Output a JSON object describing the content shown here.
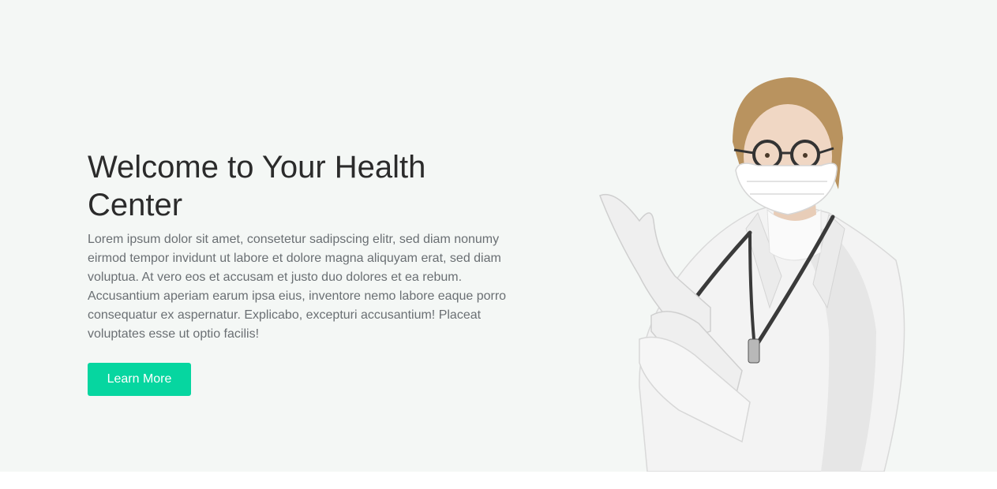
{
  "hero": {
    "title": "Welcome to Your Health Center",
    "description": "Lorem ipsum dolor sit amet, consetetur sadipscing elitr, sed diam nonumy eirmod tempor invidunt ut labore et dolore magna aliquyam erat, sed diam voluptua. At vero eos et accusam et justo duo dolores et ea rebum. Accusantium aperiam earum ipsa eius, inventore nemo labore eaque porro consequatur ex aspernatur. Explicabo, excepturi accusantium! Placeat voluptates esse ut optio facilis!",
    "button_label": "Learn More"
  },
  "colors": {
    "accent": "#06d6a0",
    "hero_background": "#f4f7f5",
    "title": "#2b2b2b",
    "body_text": "#6a6f73"
  }
}
